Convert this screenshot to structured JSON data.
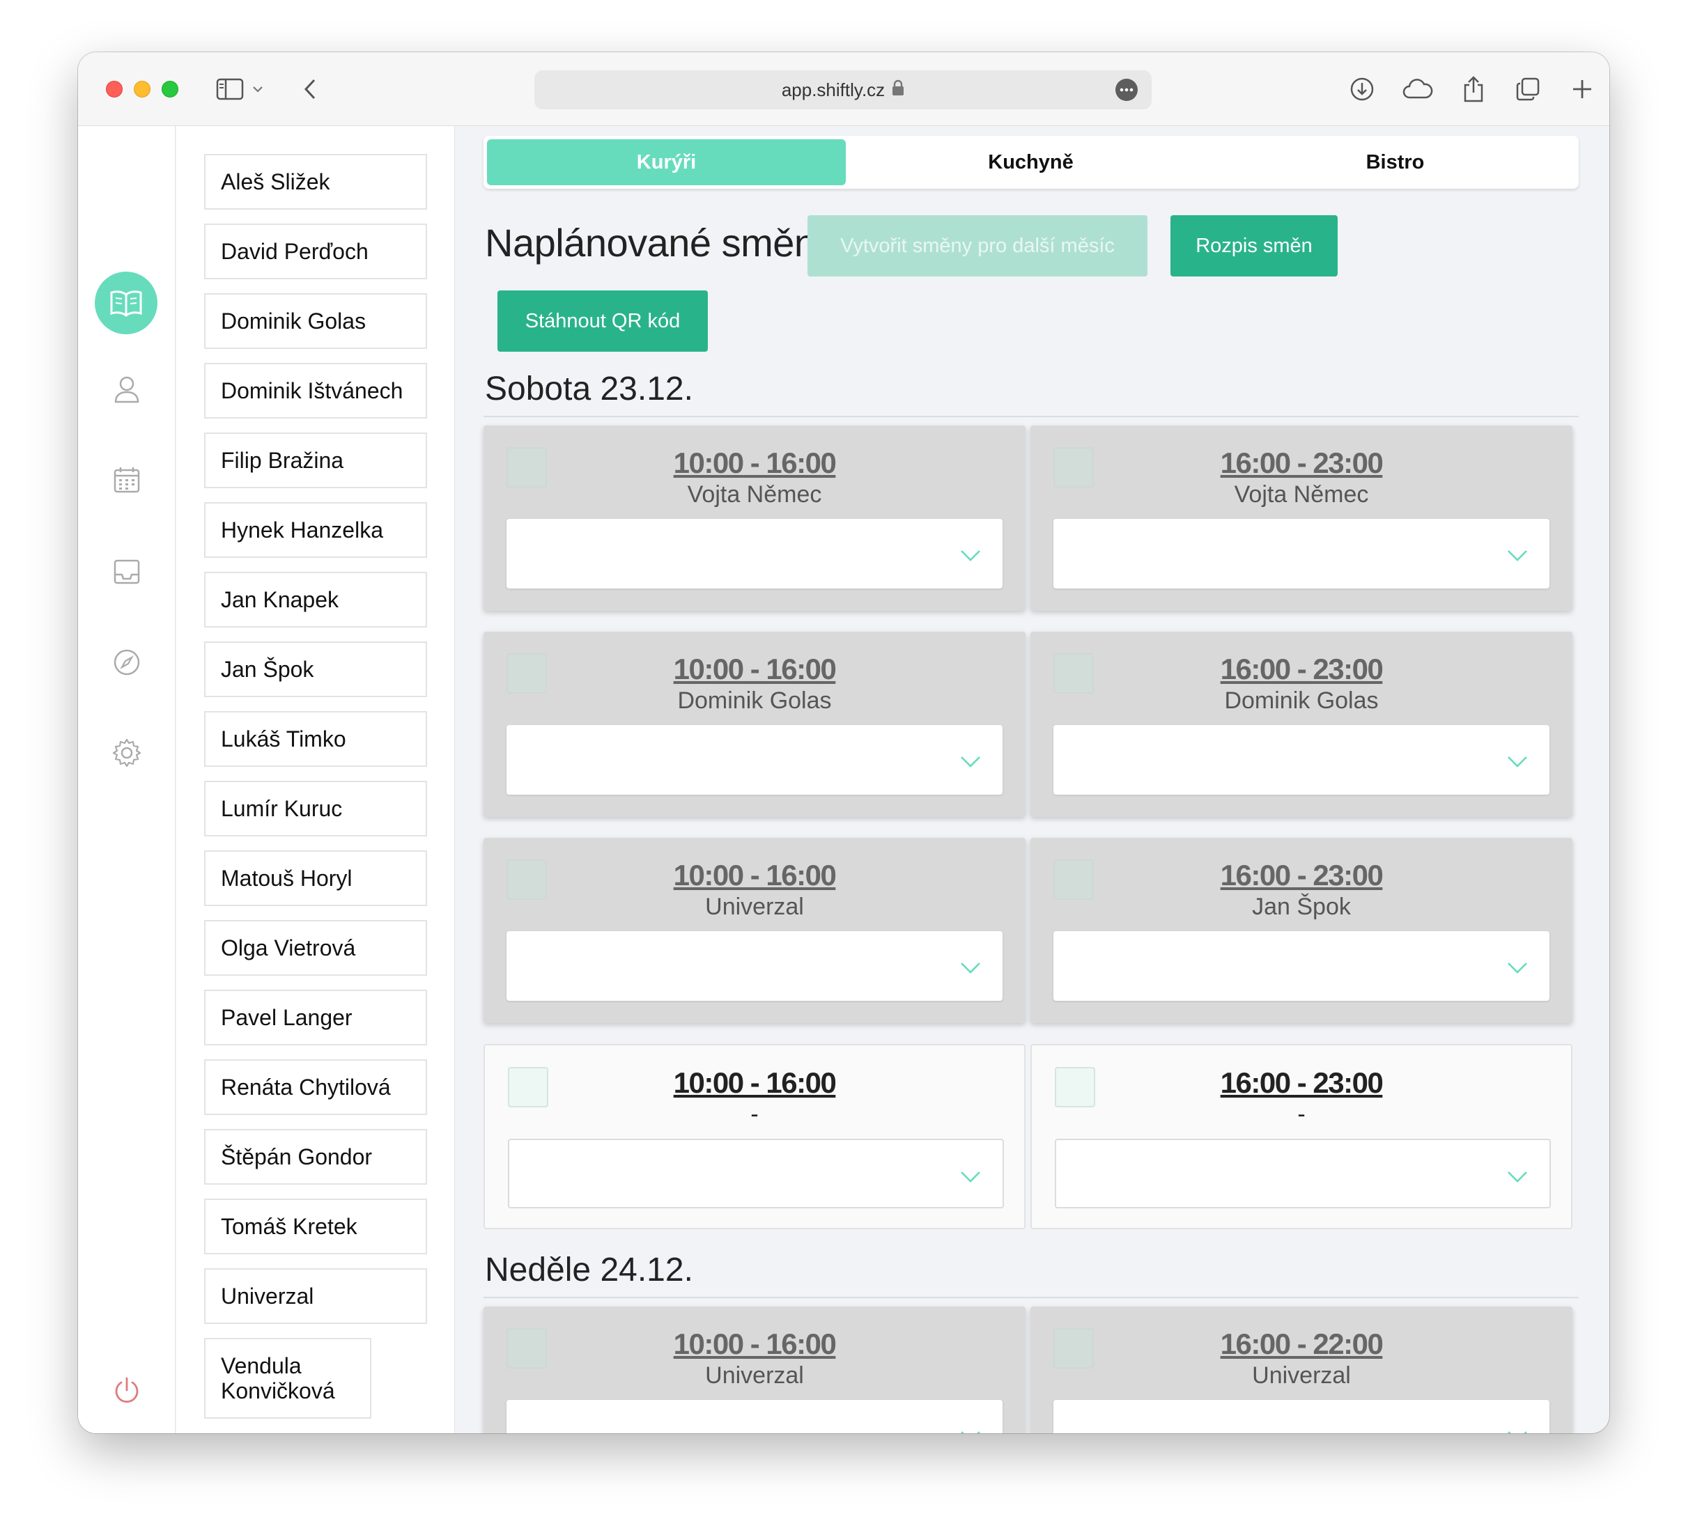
{
  "browser": {
    "url": "app.shiftly.cz"
  },
  "sidebar": {
    "rail_icons": [
      "book-icon",
      "user-icon",
      "calendar-icon",
      "inbox-icon",
      "compass-icon",
      "settings-icon",
      "power-icon"
    ],
    "accent": "#66dcbd"
  },
  "people": [
    "Aleš Sližek",
    "David Perďoch",
    "Dominik Golas",
    "Dominik Ištvánech",
    "Filip Bražina",
    "Hynek Hanzelka",
    "Jan Knapek",
    "Jan Špok",
    "Lukáš Timko",
    "Lumír Kuruc",
    "Matouš Horyl",
    "Olga Vietrová",
    "Pavel Langer",
    "Renáta Chytilová",
    "Štěpán Gondor",
    "Tomáš Kretek",
    "Univerzal",
    "Vendula Konvičková"
  ],
  "tabs": [
    {
      "label": "Kurýři",
      "active": true
    },
    {
      "label": "Kuchyně",
      "active": false
    },
    {
      "label": "Bistro",
      "active": false
    }
  ],
  "page": {
    "title": "Naplánované směny",
    "btn_next_month": "Vytvořit směny pro další měsíc",
    "btn_schedule": "Rozpis směn",
    "btn_qr": "Stáhnout QR kód"
  },
  "days": [
    {
      "heading": "Sobota 23.12.",
      "shifts": [
        {
          "time": "10:00 - 16:00",
          "person": "Vojta Němec",
          "assigned": true
        },
        {
          "time": "16:00 - 23:00",
          "person": "Vojta Němec",
          "assigned": true
        },
        {
          "time": "10:00 - 16:00",
          "person": "Dominik Golas",
          "assigned": true
        },
        {
          "time": "16:00 - 23:00",
          "person": "Dominik Golas",
          "assigned": true
        },
        {
          "time": "10:00 - 16:00",
          "person": "Univerzal",
          "assigned": true
        },
        {
          "time": "16:00 - 23:00",
          "person": "Jan Špok",
          "assigned": true
        },
        {
          "time": "10:00 - 16:00",
          "person": "-",
          "assigned": false
        },
        {
          "time": "16:00 - 23:00",
          "person": "-",
          "assigned": false
        }
      ]
    },
    {
      "heading": "Neděle 24.12.",
      "shifts": [
        {
          "time": "10:00 - 16:00",
          "person": "Univerzal",
          "assigned": true
        },
        {
          "time": "16:00 - 22:00",
          "person": "Univerzal",
          "assigned": true
        }
      ]
    }
  ]
}
